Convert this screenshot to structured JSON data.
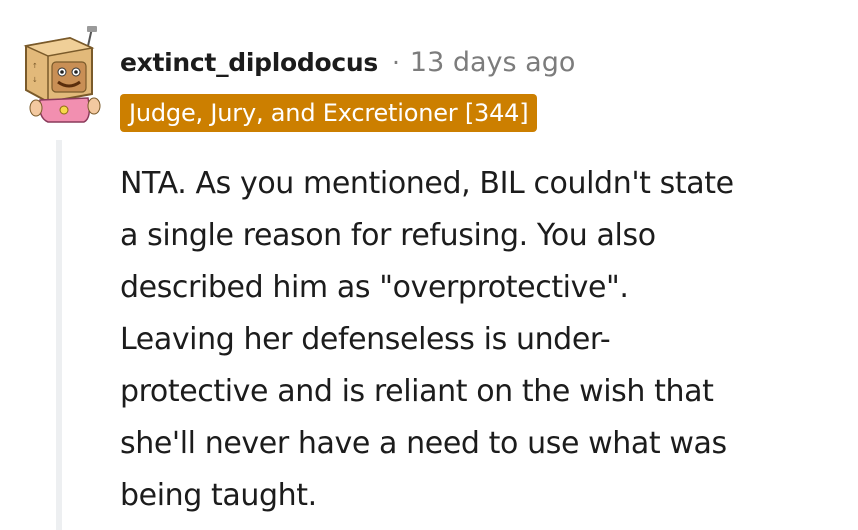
{
  "comment": {
    "username": "extinct_diplodocus",
    "separator": "·",
    "timestamp": "13 days ago",
    "flair": "Judge, Jury, and Excretioner [344]",
    "avatar_icon": "snoo-box-head-avatar-icon",
    "body": "NTA. As you mentioned, BIL couldn't state\na single reason for refusing. You also\ndescribed him as \"overprotective\".\nLeaving her defenseless is under-\nprotective and is reliant on the wish that\nshe'll never have a need to use what was\nbeing taught."
  },
  "colors": {
    "flair_bg": "#cc7f00",
    "username": "#1c1c1c",
    "meta": "#7c7c7c",
    "thread_line": "#edeff1"
  }
}
